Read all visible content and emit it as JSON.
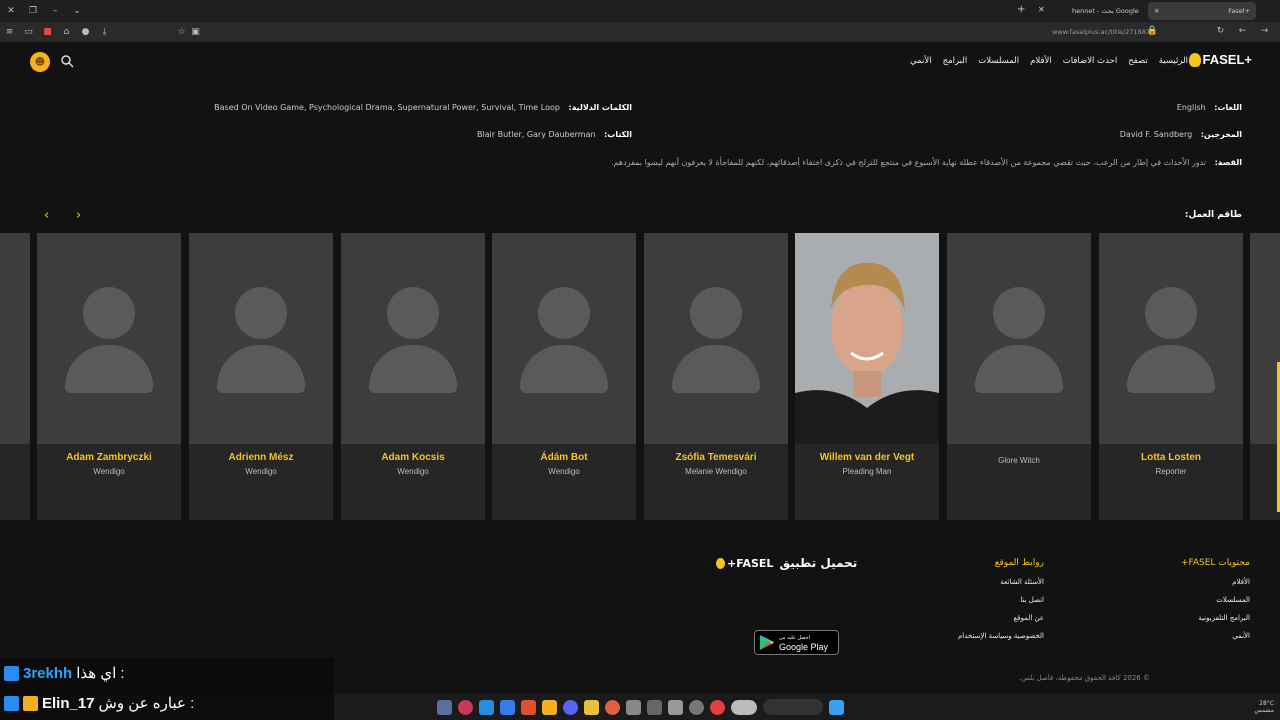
{
  "browser": {
    "tabs": [
      {
        "label": "Fasel+",
        "active": true
      },
      {
        "label": "hennet - بحث Google",
        "active": false
      }
    ],
    "url": "www.faselplus.ac/title/271887"
  },
  "nav": {
    "logo": "FASEL+",
    "links": [
      "الرئيسية",
      "تصفح",
      "احدث الاضافات",
      "الأفلام",
      "المسلسلات",
      "البرامج",
      "الأنمي"
    ]
  },
  "details": {
    "languages_label": "اللغات:",
    "languages_value": "English",
    "directors_label": "المخرجين:",
    "directors_value": "David F. Sandberg",
    "keywords_label": "الكلمات الدلالية:",
    "keywords_value": "Based On Video Game, Psychological Drama, Supernatural Power, Survival, Time Loop",
    "writers_label": "الكتاب:",
    "writers_value": "Blair Butler, Gary Dauberman",
    "story_label": "القصة:",
    "story_value": "تدور الأحداث في إطار من الرعب، حيث تقضي مجموعة من الأصدقاء عطلة نهاية الأسبوع في منتجع للتزلج في ذكرى اختفاء أصدقائهم، لكنهم للمفاجأة لا يعرفون أنهم ليسوا بمفردهم."
  },
  "cast_section": {
    "title": "طاقم العمل:",
    "members": [
      {
        "name": "Adam Zambryczki",
        "role": "Wendigo",
        "has_photo": false
      },
      {
        "name": "Adrienn Mész",
        "role": "Wendigo",
        "has_photo": false
      },
      {
        "name": "Adam Kocsis",
        "role": "Wendigo",
        "has_photo": false
      },
      {
        "name": "Ádám Bot",
        "role": "Wendigo",
        "has_photo": false
      },
      {
        "name": "Zsófia Temesvári",
        "role": "Melanie Wendigo",
        "has_photo": false
      },
      {
        "name": "Willem van der Vegt",
        "role": "Pleading Man",
        "has_photo": true
      },
      {
        "name": "",
        "role": "Glore Witch",
        "has_photo": false
      },
      {
        "name": "Lotta Losten",
        "role": "Reporter",
        "has_photo": false
      }
    ]
  },
  "footer": {
    "content_title": "محتويات FASEL+",
    "content_links": [
      "الأفلام",
      "المسلسلات",
      "البرامج التلفزيونية",
      "الأنمي"
    ],
    "site_title": "روابط الموقع",
    "site_links": [
      "الأسئلة الشائعة",
      "اتصل بنا",
      "عن الموقع",
      "الخصوصية وسياسة الإستخدام"
    ],
    "app_title": "تحميل تطبيق",
    "app_logo": "FASEL+",
    "gplay_small": "احصل عليه من",
    "gplay_big": "Google Play",
    "copyright": "© 2026 كافة الحقوق محفوظة، فاصل بلس."
  },
  "chat": [
    {
      "user": "3rekhh",
      "message": "اي هذا :"
    },
    {
      "user": "Elin_17",
      "message": "عباره عن وش :"
    }
  ],
  "tray": {
    "temp": "28°C",
    "weather": "مشمس"
  }
}
